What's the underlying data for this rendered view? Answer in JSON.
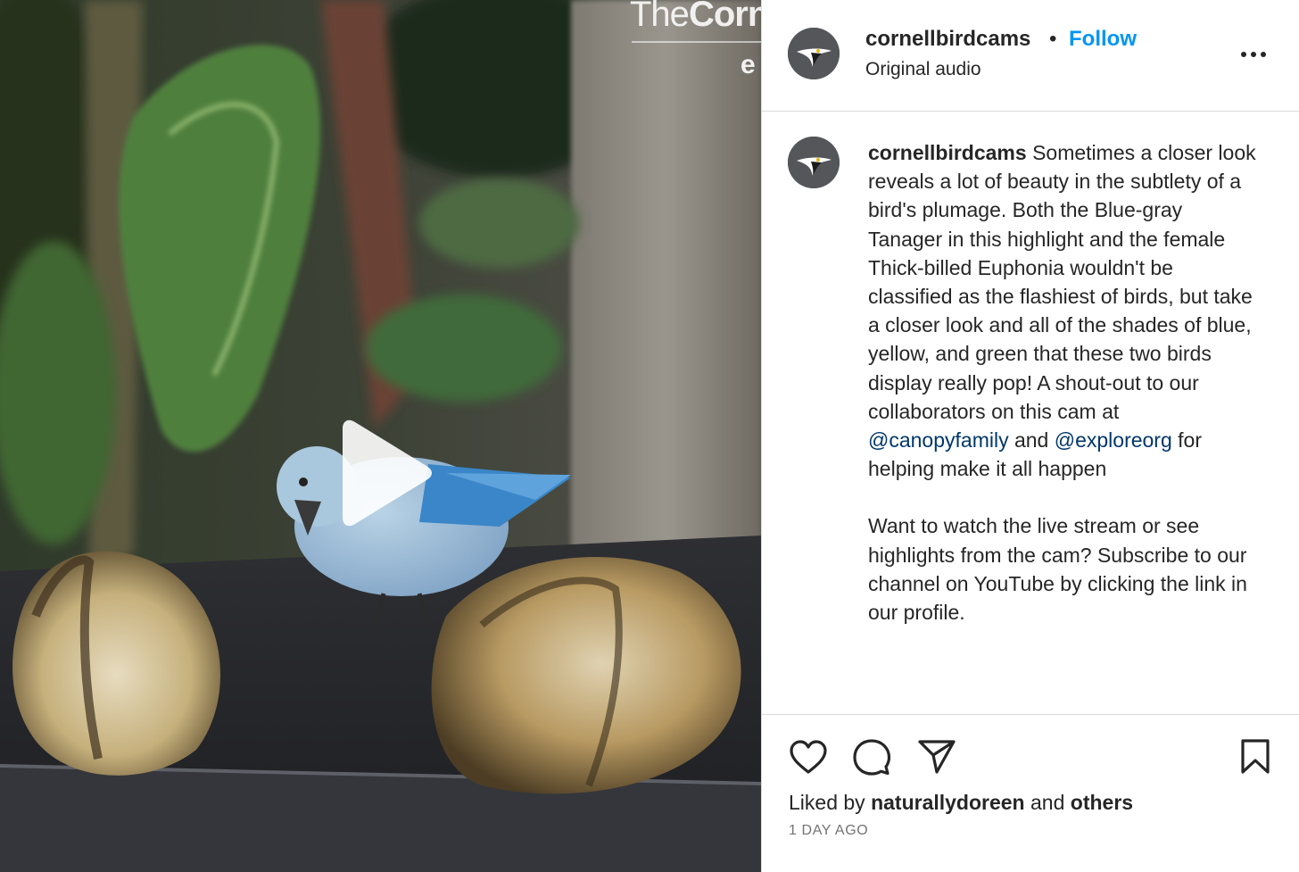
{
  "media": {
    "watermark_light": "The",
    "watermark_bold": "Corn",
    "watermark_sub": "e"
  },
  "header": {
    "username": "cornellbirdcams",
    "separator": "•",
    "follow_label": "Follow",
    "audio": "Original audio"
  },
  "caption": {
    "username": "cornellbirdcams",
    "text_1": " Sometimes a closer look reveals a lot of beauty in the subtlety of a bird's plumage. Both the Blue-gray Tanager in this highlight and the female Thick-billed Euphonia wouldn't be classified as the flashiest of birds, but take a closer look and all of the shades of blue, yellow, and green that these two birds display really pop! A shout-out to our collaborators on this cam at ",
    "mention_1": "@canopyfamily",
    "text_2": " and ",
    "mention_2": "@exploreorg",
    "text_3": " for helping make it all happen",
    "paragraph_2": "Want to watch the live stream or see highlights from the cam? Subscribe to our channel on YouTube by clicking the link in our profile."
  },
  "likes": {
    "prefix": "Liked by ",
    "user": "naturallydoreen",
    "middle": " and ",
    "others": "others"
  },
  "timestamp": "1 DAY AGO",
  "colors": {
    "follow": "#0095f6",
    "mention": "#00376b",
    "divider": "#dbdbdb",
    "muted": "#737373",
    "avatar_bg": "#55565a"
  },
  "icons": {
    "play": "play-icon",
    "more": "more-options-icon",
    "like": "heart-icon",
    "comment": "comment-icon",
    "share": "share-icon",
    "save": "bookmark-icon"
  }
}
